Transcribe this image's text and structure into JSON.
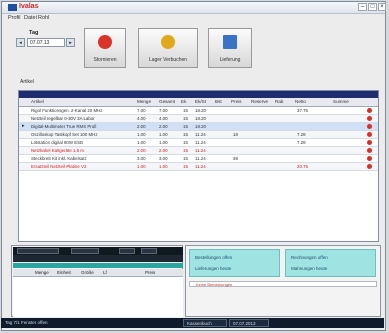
{
  "titlebar": {
    "app_title": "Ivalas"
  },
  "menu": {
    "items": [
      "Profil",
      "Datei",
      "Rohl"
    ]
  },
  "toolbar": {
    "date_label": "Tag",
    "date_value": "07.07.13",
    "buttons": [
      {
        "label": "Stornieren",
        "icon": "stop-icon",
        "color": "#d8342a"
      },
      {
        "label": "Lager Verbuchen",
        "icon": "person-icon",
        "color": "#e0a81a"
      },
      {
        "label": "Lieferung",
        "icon": "document-icon",
        "color": "#3a72c8"
      }
    ]
  },
  "section_label": "Artikel",
  "grid": {
    "columns": [
      "Artikel",
      "Menge",
      "Gesamt",
      "Ek",
      "Ek/St",
      "Bst",
      "Preis",
      "Reserve",
      "Rab",
      "Netto",
      "Summe"
    ],
    "rows": [
      {
        "artikel": "Rigol Funktionsgen. 2-Kanal 20 MHz",
        "menge": "7.00",
        "gesamt": "7.00",
        "ek": "15",
        "ek_st": "18.20",
        "bst": "",
        "preis": "",
        "reserve": "",
        "rab": "",
        "netto": "37.75",
        "summe": "",
        "color": "#333",
        "highlight": false
      },
      {
        "artikel": "Netzteil regelbar 0-30V 3A Labor",
        "menge": "4.00",
        "gesamt": "4.00",
        "ek": "15",
        "ek_st": "18.20",
        "bst": "",
        "preis": "",
        "reserve": "",
        "rab": "",
        "netto": "",
        "summe": "",
        "color": "#333",
        "highlight": false
      },
      {
        "artikel": "Digital-Multimeter True RMS Profi",
        "menge": "2.00",
        "gesamt": "2.00",
        "ek": "15",
        "ek_st": "18.20",
        "bst": "",
        "preis": "",
        "reserve": "",
        "rab": "",
        "netto": "",
        "summe": "",
        "color": "#333",
        "highlight": true
      },
      {
        "artikel": "Oszilloskop Tastkopf Set 100 MHz",
        "menge": "1.00",
        "gesamt": "1.00",
        "ek": "15",
        "ek_st": "11.24",
        "bst": "",
        "preis": "18",
        "reserve": "",
        "rab": "",
        "netto": "7.28",
        "summe": "",
        "color": "#333",
        "highlight": false
      },
      {
        "artikel": "Lötstation digital 80W ESD",
        "menge": "1.00",
        "gesamt": "1.00",
        "ek": "15",
        "ek_st": "11.24",
        "bst": "",
        "preis": "",
        "reserve": "",
        "rab": "",
        "netto": "7.28",
        "summe": "",
        "color": "#333",
        "highlight": false
      },
      {
        "artikel": "Netzkabel Kaltgeräte 1.5 m",
        "menge": "2.00",
        "gesamt": "2.00",
        "ek": "15",
        "ek_st": "11.24",
        "bst": "",
        "preis": "",
        "reserve": "",
        "rab": "",
        "netto": "",
        "summe": "",
        "color": "#d02020",
        "highlight": false
      },
      {
        "artikel": "Steckbrett Kit inkl. Kabelsatz",
        "menge": "3.00",
        "gesamt": "3.00",
        "ek": "15",
        "ek_st": "11.24",
        "bst": "",
        "preis": "38",
        "reserve": "",
        "rab": "",
        "netto": "",
        "summe": "",
        "color": "#333",
        "highlight": false
      },
      {
        "artikel": "Ersatzteil Netzteil-Platine V2",
        "menge": "1.00",
        "gesamt": "1.00",
        "ek": "15",
        "ek_st": "11.24",
        "bst": "",
        "preis": "",
        "reserve": "",
        "rab": "",
        "netto": "20.75",
        "summe": "",
        "color": "#d02020",
        "highlight": false
      }
    ]
  },
  "footer_left": {
    "boxes": [
      "",
      "",
      "",
      ""
    ],
    "columns": [
      "Menge",
      "Einheit",
      "Größe",
      "Lf",
      "Preis"
    ]
  },
  "footer_right": {
    "panel_left": [
      "Bestellungen offen",
      "Lieferungen heute"
    ],
    "panel_right": [
      "Rechnungen offen",
      "Mahnungen heute"
    ],
    "strip_text": "Keine Bemerkungen"
  },
  "statusbar": {
    "left": "Tag 7/1 Fenster offen",
    "mid_label": "Kassenbuch",
    "right": "07.07.2013"
  },
  "colors": {
    "accent": "#1d2d6e",
    "teal": "#2aa6a0",
    "info": "#9fe3e2"
  }
}
